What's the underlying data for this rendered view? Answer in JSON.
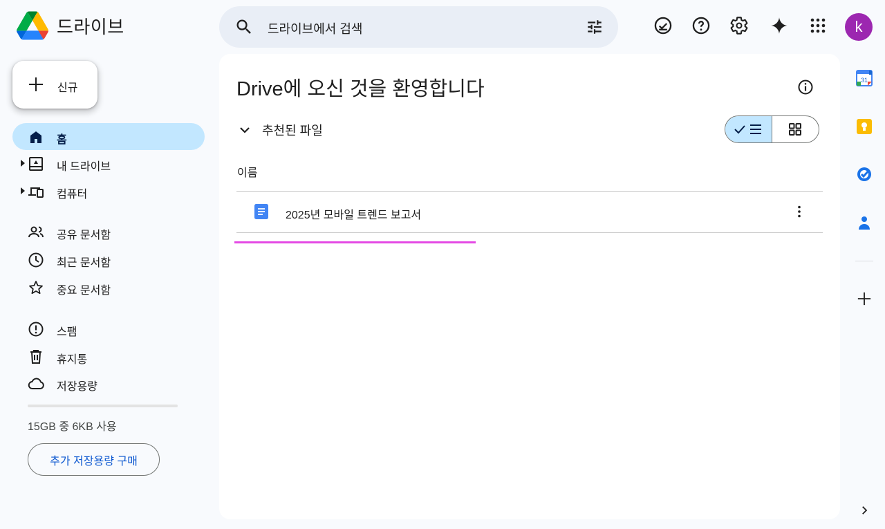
{
  "app": {
    "name": "드라이브",
    "logo_colors": [
      "#0066da",
      "#00ac47",
      "#ea4335",
      "#00832d",
      "#2684fc",
      "#ffba00"
    ]
  },
  "search": {
    "placeholder": "드라이브에서 검색",
    "icons": [
      "search-icon",
      "tune-icon"
    ]
  },
  "header_icons": [
    "offline-check-icon",
    "help-icon",
    "settings-icon",
    "gemini-sparkle-icon",
    "apps-grid-icon"
  ],
  "account": {
    "initial": "k",
    "color": "#9c27b0"
  },
  "sidebar": {
    "new_label": "신규",
    "items": [
      {
        "label": "홈",
        "icon": "home-icon",
        "active": true
      },
      {
        "label": "내 드라이브",
        "icon": "my-drive-icon",
        "expandable": true
      },
      {
        "label": "컴퓨터",
        "icon": "computers-icon",
        "expandable": true
      },
      {
        "label": "공유 문서함",
        "icon": "shared-icon"
      },
      {
        "label": "최근 문서함",
        "icon": "clock-icon"
      },
      {
        "label": "중요 문서함",
        "icon": "star-icon"
      },
      {
        "label": "스팸",
        "icon": "spam-icon"
      },
      {
        "label": "휴지통",
        "icon": "trash-icon"
      },
      {
        "label": "저장용량",
        "icon": "cloud-icon"
      }
    ],
    "storage": {
      "text": "15GB 중 6KB 사용",
      "used_fraction": 0.0
    },
    "buy_label": "추가 저장용량 구매"
  },
  "main": {
    "title": "Drive에 오신 것을 환영합니다",
    "section_label": "추천된 파일",
    "view_toggle": {
      "selected": "list",
      "options": [
        "list",
        "grid"
      ]
    },
    "column_header": "이름",
    "files": [
      {
        "name": "2025년 모바일 트렌드 보고서",
        "type": "google-docs"
      }
    ]
  },
  "side_panel": [
    "calendar-icon",
    "keep-icon",
    "tasks-icon",
    "contacts-icon",
    "add-icon"
  ],
  "calendar_day": "31",
  "colors": {
    "accent": "#0b57d0",
    "active_nav": "#c2e7ff",
    "highlight": "#e44ae4",
    "background": "#f8fafd"
  }
}
